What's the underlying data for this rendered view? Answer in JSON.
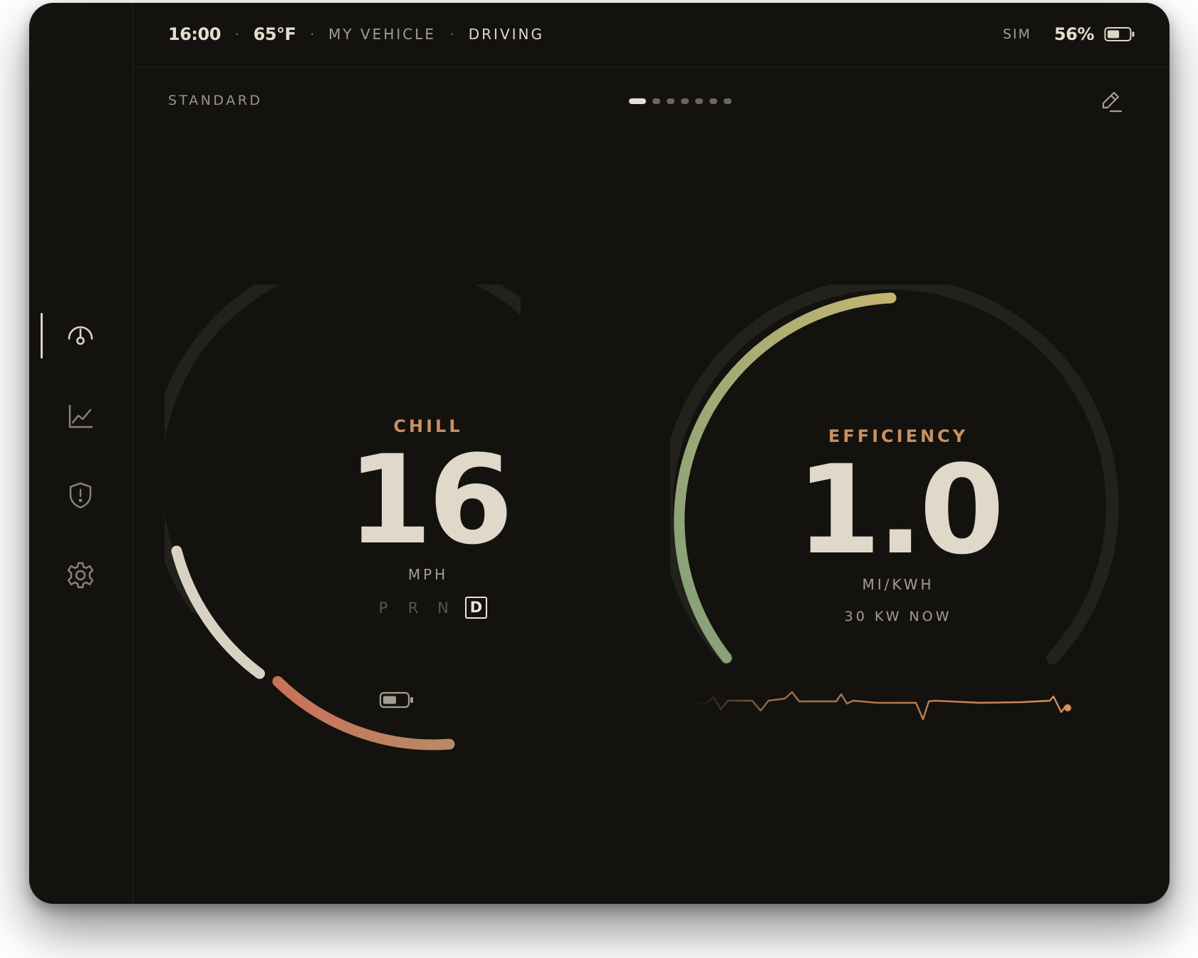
{
  "status": {
    "time": "16:00",
    "temperature": "65°F",
    "vehicle": "MY VEHICLE",
    "state": "DRIVING",
    "separator": "·",
    "sim": "SIM",
    "battery_percent": "56%",
    "battery_level": 0.56
  },
  "sidebar": {
    "items": [
      {
        "icon": "gauge-icon",
        "active": true
      },
      {
        "icon": "chart-icon",
        "active": false
      },
      {
        "icon": "shield-alert-icon",
        "active": false
      },
      {
        "icon": "gear-icon",
        "active": false
      }
    ]
  },
  "header": {
    "mode": "STANDARD",
    "pages": 7,
    "active_page": 1,
    "edit_icon": "pencil-icon"
  },
  "speed_gauge": {
    "mode": "CHILL",
    "value": "16",
    "unit": "MPH",
    "gears": [
      "P",
      "R",
      "N",
      "D"
    ],
    "selected_gear": "D",
    "battery_icon": "battery-icon",
    "colors": {
      "track": "#26241f",
      "speed_arc": "#d9d2c2",
      "regen_start": "#c9725a",
      "regen_end": "#b98a66"
    }
  },
  "efficiency_gauge": {
    "label": "EFFICIENCY",
    "value": "1.0",
    "unit": "MI/KWH",
    "power_now": "30 KW NOW",
    "colors": {
      "track": "#26241f",
      "arc_start": "#83a07a",
      "arc_end": "#c3b570",
      "sparkline": "#c98a5a"
    }
  }
}
